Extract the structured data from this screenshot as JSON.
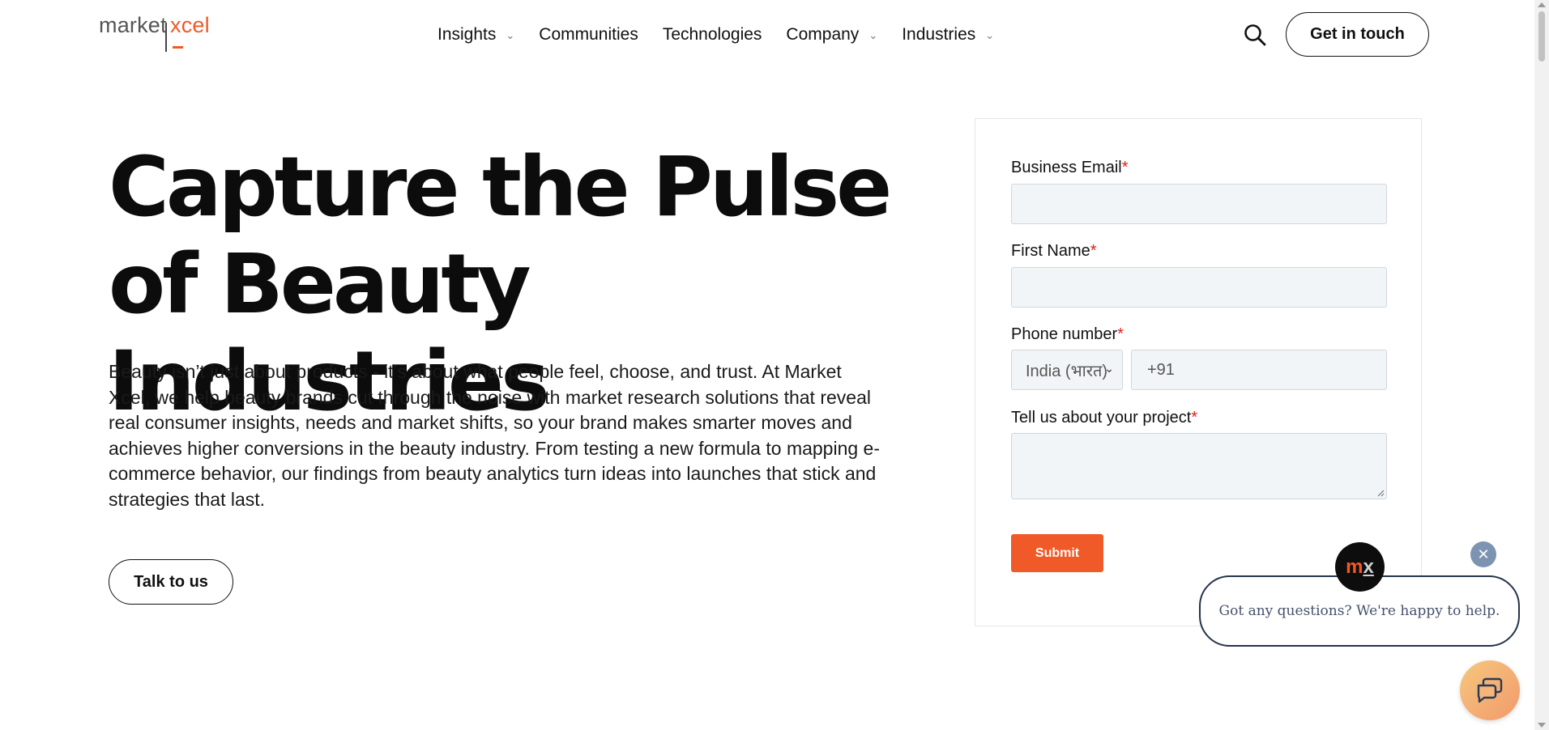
{
  "header": {
    "logo": {
      "part1": "market",
      "part2": "xcel"
    },
    "nav": [
      {
        "label": "Insights",
        "has_dropdown": true
      },
      {
        "label": "Communities",
        "has_dropdown": false
      },
      {
        "label": "Technologies",
        "has_dropdown": false
      },
      {
        "label": "Company",
        "has_dropdown": true
      },
      {
        "label": "Industries",
        "has_dropdown": true
      }
    ],
    "search_icon": "search-icon",
    "cta_label": "Get in touch"
  },
  "hero": {
    "title_line1": "Capture the Pulse",
    "title_line2": "of Beauty Industries",
    "body": "Beauty isn’t just about products - it’s about what people feel, choose, and trust. At Market Xcel, we help beauty brands cut through the noise with market research solutions that reveal real consumer insights, needs and market shifts, so your brand makes smarter moves and achieves higher conversions in the beauty industry. From testing a new formula to mapping e-commerce behavior, our findings from beauty analytics turn ideas into launches that stick and strategies that last.",
    "button_label": "Talk to us"
  },
  "form": {
    "email_label": "Business Email",
    "first_name_label": "First Name",
    "phone_label": "Phone number",
    "country_value": "India (भारत)",
    "phone_value": "+91",
    "project_label": "Tell us about your project",
    "required_mark": "*",
    "submit_label": "Submit"
  },
  "chat": {
    "avatar_m": "m",
    "avatar_x": "x",
    "message": "Got any questions? We're happy to help.",
    "close_icon": "close-icon",
    "launcher_icon": "chat-icon"
  },
  "colors": {
    "accent": "#f05a28",
    "required": "#e11d1d",
    "chat_border": "#24344a",
    "close_bg": "#7d93b2"
  }
}
